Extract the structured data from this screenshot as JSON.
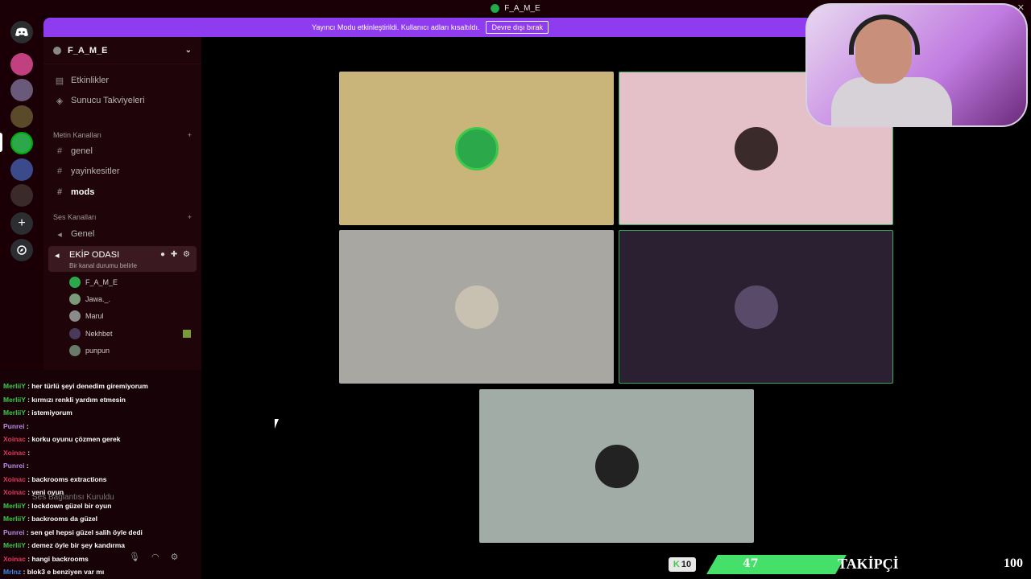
{
  "window": {
    "title": "F_A_M_E",
    "close_glyph": "✕"
  },
  "banner": {
    "text": "Yayıncı Modu etkinleştirildi. Kullanıcı adları kısaltıldı.",
    "button": "Devre dışı bırak"
  },
  "server": {
    "name": "F_A_M_E"
  },
  "sidebar": {
    "events": "Etkinlikler",
    "boosts": "Sunucu Takviyeleri",
    "text_category": "Metin Kanalları",
    "text_channels": [
      "genel",
      "yayinkesitler",
      "mods"
    ],
    "voice_category": "Ses Kanalları",
    "voice_channels": [
      "Genel"
    ],
    "active_voice": {
      "name": "EKİP ODASI",
      "status": "Bir kanal durumu belirle"
    },
    "members": [
      "F_A_M_E",
      "Jawa._.",
      "Marul",
      "Nekhbet",
      "punpun"
    ]
  },
  "chat": {
    "messages": [
      {
        "user": "MerliiY",
        "text": ": her türlü şeyi denedim giremiyorum",
        "color": "#3ec94a"
      },
      {
        "user": "MerliiY",
        "text": ": kırmızı renkli yardım etmesin",
        "color": "#3ec94a"
      },
      {
        "user": "MerliiY",
        "text": ": istemiyorum",
        "color": "#3ec94a"
      },
      {
        "user": "Punrei",
        "text": ":",
        "color": "#b98ae8"
      },
      {
        "user": "Xoinac",
        "text": ": korku oyunu çözmen gerek",
        "color": "#e0365a"
      },
      {
        "user": "Xoinac",
        "text": ":",
        "color": "#e0365a"
      },
      {
        "user": "Punrei",
        "text": ":",
        "color": "#b98ae8"
      },
      {
        "user": "Xoinac",
        "text": ": backrooms extractions",
        "color": "#e0365a"
      },
      {
        "user": "Xoinac",
        "text": ": yeni oyun",
        "color": "#e0365a"
      },
      {
        "user": "MerliiY",
        "text": ": lockdown güzel bir oyun",
        "color": "#3ec94a"
      },
      {
        "user": "MerliiY",
        "text": ": backrooms da güzel",
        "color": "#3ec94a"
      },
      {
        "user": "Punrei",
        "text": ": sen gel hepsi güzel salih öyle dedi",
        "color": "#b98ae8"
      },
      {
        "user": "MerliiY",
        "text": ": demez öyle bir şey kandırma",
        "color": "#3ec94a"
      },
      {
        "user": "Xoinac",
        "text": ": hangi backrooms",
        "color": "#e0365a"
      },
      {
        "user": "Mrlnz",
        "text": ": blok3 e benziyen var mı",
        "color": "#3e8ae8"
      }
    ],
    "voice_status": "Ses Bağlantısı Kuruldu"
  },
  "follower_goal": {
    "badge": "10",
    "current": "47",
    "label": "TAKİPÇİ",
    "goal": "100",
    "progress_fraction": 0.47
  },
  "colors": {
    "accent": "#8f3cf0",
    "speaking": "#3ba55d",
    "sidebar": "#1f0409"
  }
}
